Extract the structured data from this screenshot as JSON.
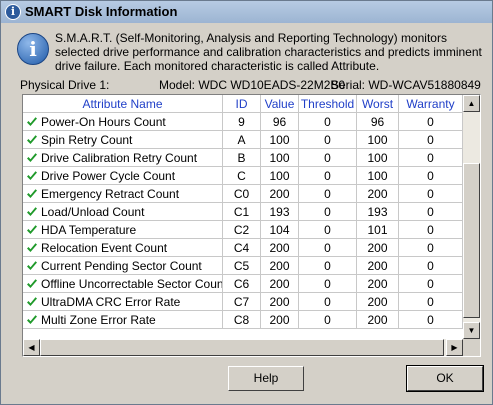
{
  "window": {
    "title": "SMART Disk Information"
  },
  "description": "S.M.A.R.T. (Self-Monitoring, Analysis and Reporting Technology) monitors selected drive performance and calibration characteristics and predicts imminent drive failure. Each monitored characteristic is called Attribute.",
  "drive": {
    "label": "Physical Drive 1:",
    "model": "Model: WDC WD10EADS-22M2B0",
    "serial": "Serial: WD-WCAV51880849"
  },
  "columns": {
    "name": "Attribute Name",
    "id": "ID",
    "value": "Value",
    "threshold": "Threshold",
    "worst": "Worst",
    "warranty": "Warranty"
  },
  "attributes": [
    {
      "name": "Power-On Hours Count",
      "id": "9",
      "value": "96",
      "threshold": "0",
      "worst": "96",
      "warranty": "0"
    },
    {
      "name": "Spin Retry Count",
      "id": "A",
      "value": "100",
      "threshold": "0",
      "worst": "100",
      "warranty": "0"
    },
    {
      "name": "Drive Calibration Retry Count",
      "id": "B",
      "value": "100",
      "threshold": "0",
      "worst": "100",
      "warranty": "0"
    },
    {
      "name": "Drive Power Cycle Count",
      "id": "C",
      "value": "100",
      "threshold": "0",
      "worst": "100",
      "warranty": "0"
    },
    {
      "name": "Emergency Retract Count",
      "id": "C0",
      "value": "200",
      "threshold": "0",
      "worst": "200",
      "warranty": "0"
    },
    {
      "name": "Load/Unload Count",
      "id": "C1",
      "value": "193",
      "threshold": "0",
      "worst": "193",
      "warranty": "0"
    },
    {
      "name": "HDA Temperature",
      "id": "C2",
      "value": "104",
      "threshold": "0",
      "worst": "101",
      "warranty": "0"
    },
    {
      "name": "Relocation Event Count",
      "id": "C4",
      "value": "200",
      "threshold": "0",
      "worst": "200",
      "warranty": "0"
    },
    {
      "name": "Current Pending Sector Count",
      "id": "C5",
      "value": "200",
      "threshold": "0",
      "worst": "200",
      "warranty": "0"
    },
    {
      "name": "Offline Uncorrectable Sector Count",
      "id": "C6",
      "value": "200",
      "threshold": "0",
      "worst": "200",
      "warranty": "0"
    },
    {
      "name": "UltraDMA CRC Error Rate",
      "id": "C7",
      "value": "200",
      "threshold": "0",
      "worst": "200",
      "warranty": "0"
    },
    {
      "name": "Multi Zone Error Rate",
      "id": "C8",
      "value": "200",
      "threshold": "0",
      "worst": "200",
      "warranty": "0"
    }
  ],
  "buttons": {
    "help": "Help",
    "ok": "OK"
  },
  "icons": {
    "title": "info-icon",
    "info": "info-icon",
    "status": "check-icon"
  },
  "colors": {
    "header_text": "#2140c8",
    "check": "#1f9a2a"
  }
}
